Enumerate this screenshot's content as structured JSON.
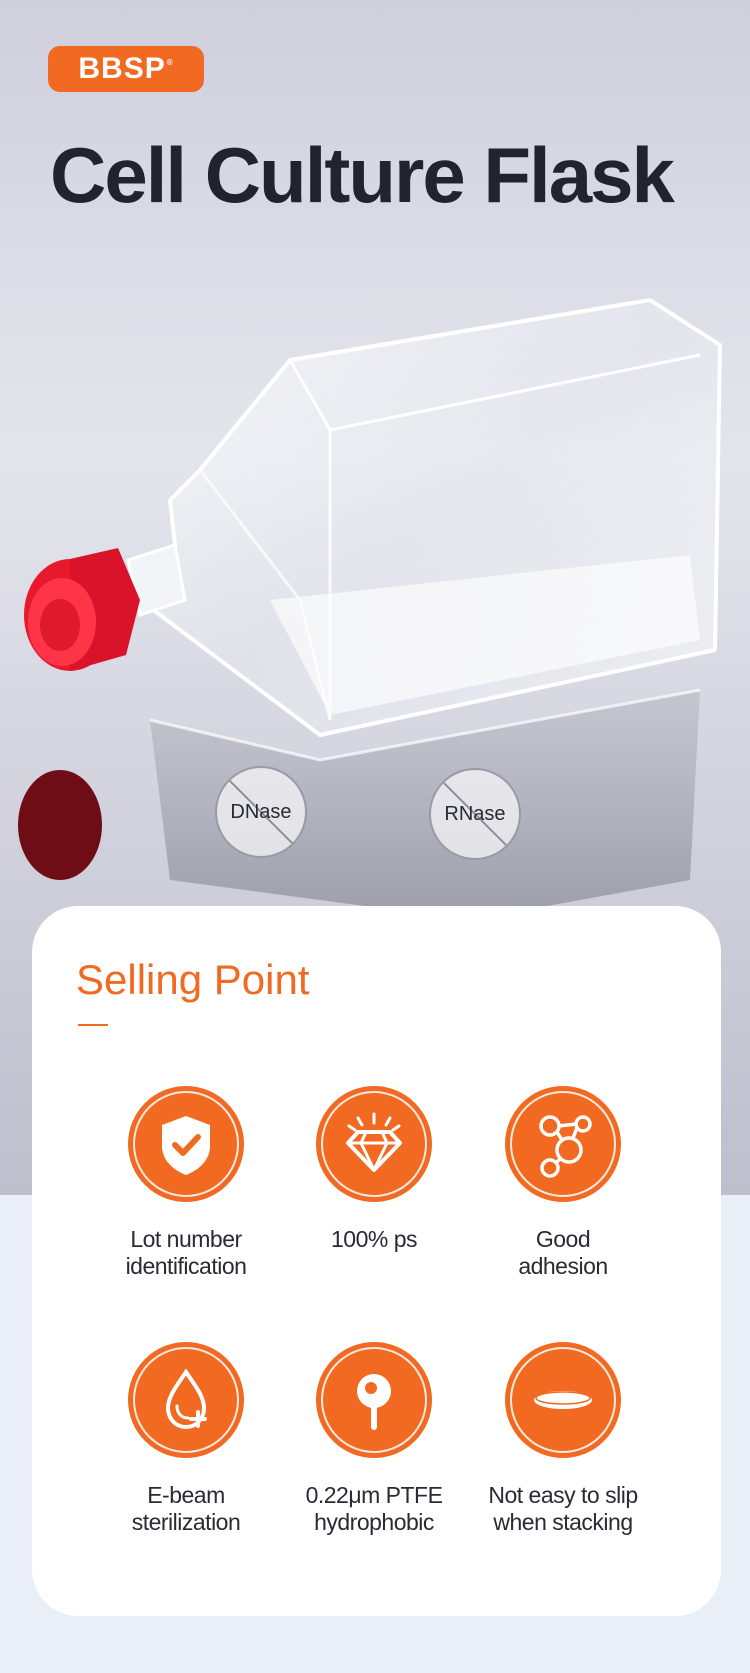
{
  "brand": {
    "logo_text": "BBSP",
    "registered": "®"
  },
  "hero": {
    "title": "Cell Culture Flask"
  },
  "badges": [
    {
      "text": "DNase"
    },
    {
      "text": "RNase"
    }
  ],
  "selling": {
    "heading": "Selling Point",
    "features": [
      {
        "icon": "shield-check-icon",
        "label": "Lot number\nidentification"
      },
      {
        "icon": "diamond-icon",
        "label": "100% ps"
      },
      {
        "icon": "molecule-icon",
        "label": "Good\nadhesion"
      },
      {
        "icon": "drop-plus-icon",
        "label": "E-beam\nsterilization"
      },
      {
        "icon": "pin-icon",
        "label": "0.22μm PTFE\nhydrophobic"
      },
      {
        "icon": "disc-icon",
        "label": "Not easy to slip\nwhen stacking"
      }
    ]
  },
  "colors": {
    "accent": "#f26a22",
    "title": "#23232e",
    "cap": "#e8192c"
  }
}
